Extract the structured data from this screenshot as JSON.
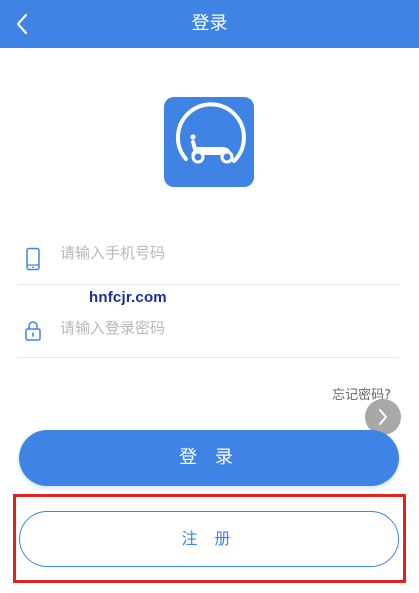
{
  "header": {
    "title": "登录",
    "back_icon": "chevron-left-icon"
  },
  "logo": {
    "icon": "scooter-icon",
    "background": "#3f84e5"
  },
  "form": {
    "phone": {
      "placeholder": "请输入手机号码",
      "value": "",
      "icon": "phone-icon"
    },
    "password": {
      "placeholder": "请输入登录密码",
      "value": "",
      "icon": "lock-icon"
    },
    "forgot_label": "忘记密码?"
  },
  "watermark": "hnfcjr.com",
  "buttons": {
    "login_label": "登 录",
    "register_label": "注 册",
    "next_icon": "chevron-right-icon"
  },
  "colors": {
    "accent": "#3f84e5",
    "highlight": "#e0231c"
  }
}
